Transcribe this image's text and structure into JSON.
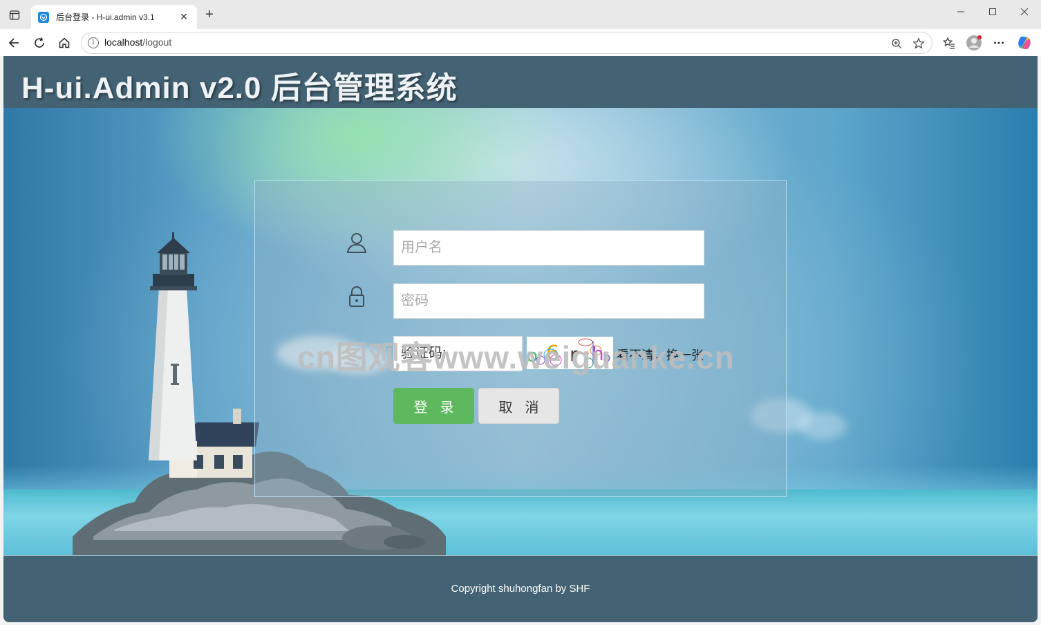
{
  "browser": {
    "tab_title": "后台登录 - H-ui.admin v3.1",
    "url_host": "localhost",
    "url_path": "/logout",
    "icons": [
      "sidebar-toggle-icon",
      "favicon-icon",
      "close-icon",
      "plus-icon",
      "minimize-icon",
      "maximize-icon",
      "close-window-icon",
      "back-icon",
      "refresh-icon",
      "home-icon",
      "info-icon",
      "zoom-icon",
      "star-icon",
      "favorites-icon",
      "profile-icon",
      "more-icon",
      "copilot-icon"
    ]
  },
  "header": {
    "logo": "H-ui.Admin v2.0 后台管理系统"
  },
  "login": {
    "username_placeholder": "用户名",
    "password_placeholder": "密码",
    "captcha_value": "验证码:",
    "captcha_refresh": "看不清，换一张",
    "login_label": "登录",
    "cancel_label": "取消",
    "captcha_image_text": "o6rhb"
  },
  "watermark": "cn图观客www.weiguanke.cn",
  "footer": {
    "copyright": "Copyright shuhongfan by SHF"
  },
  "colors": {
    "header_bg": "#436273",
    "login_btn": "#5eb95e",
    "cancel_btn": "#e6e6e6"
  }
}
